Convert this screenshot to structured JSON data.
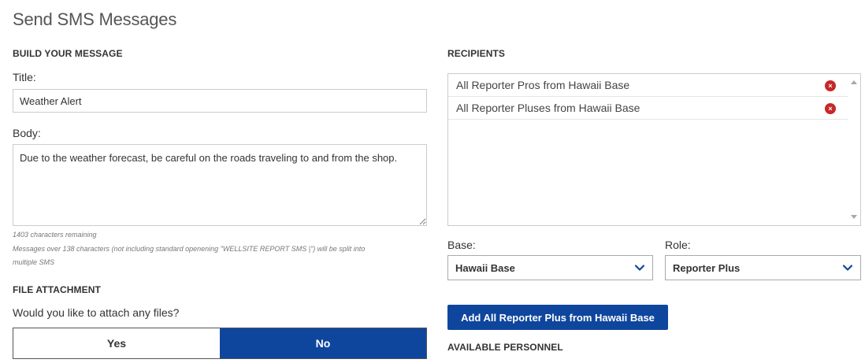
{
  "page": {
    "title": "Send SMS Messages"
  },
  "build": {
    "heading": "BUILD YOUR MESSAGE",
    "title_label": "Title:",
    "title_value": "Weather Alert",
    "body_label": "Body:",
    "body_value": "Due to the weather forecast, be careful on the roads traveling to and from the shop.",
    "chars_remaining": "1403 characters remaining",
    "split_note_line1": "Messages over 138 characters (not including standard openening \"WELLSITE REPORT SMS |\") will be split into",
    "split_note_line2": "multiple SMS"
  },
  "attachment": {
    "heading": "FILE ATTACHMENT",
    "question": "Would you like to attach any files?",
    "yes_label": "Yes",
    "no_label": "No",
    "selected": "No"
  },
  "recipients": {
    "heading": "RECIPIENTS",
    "items": [
      {
        "label": "All Reporter Pros from Hawaii Base",
        "remove_icon": "close-circle-icon"
      },
      {
        "label": "All Reporter Pluses from Hawaii Base",
        "remove_icon": "close-circle-icon"
      }
    ],
    "remove_glyph": "×"
  },
  "filters": {
    "base_label": "Base:",
    "base_value": "Hawaii Base",
    "role_label": "Role:",
    "role_value": "Reporter Plus"
  },
  "actions": {
    "add_all_label": "Add All Reporter Plus from Hawaii Base"
  },
  "personnel": {
    "heading": "AVAILABLE PERSONNEL"
  },
  "colors": {
    "primary": "#0f469d",
    "danger": "#c62828",
    "border": "#cccccc"
  }
}
